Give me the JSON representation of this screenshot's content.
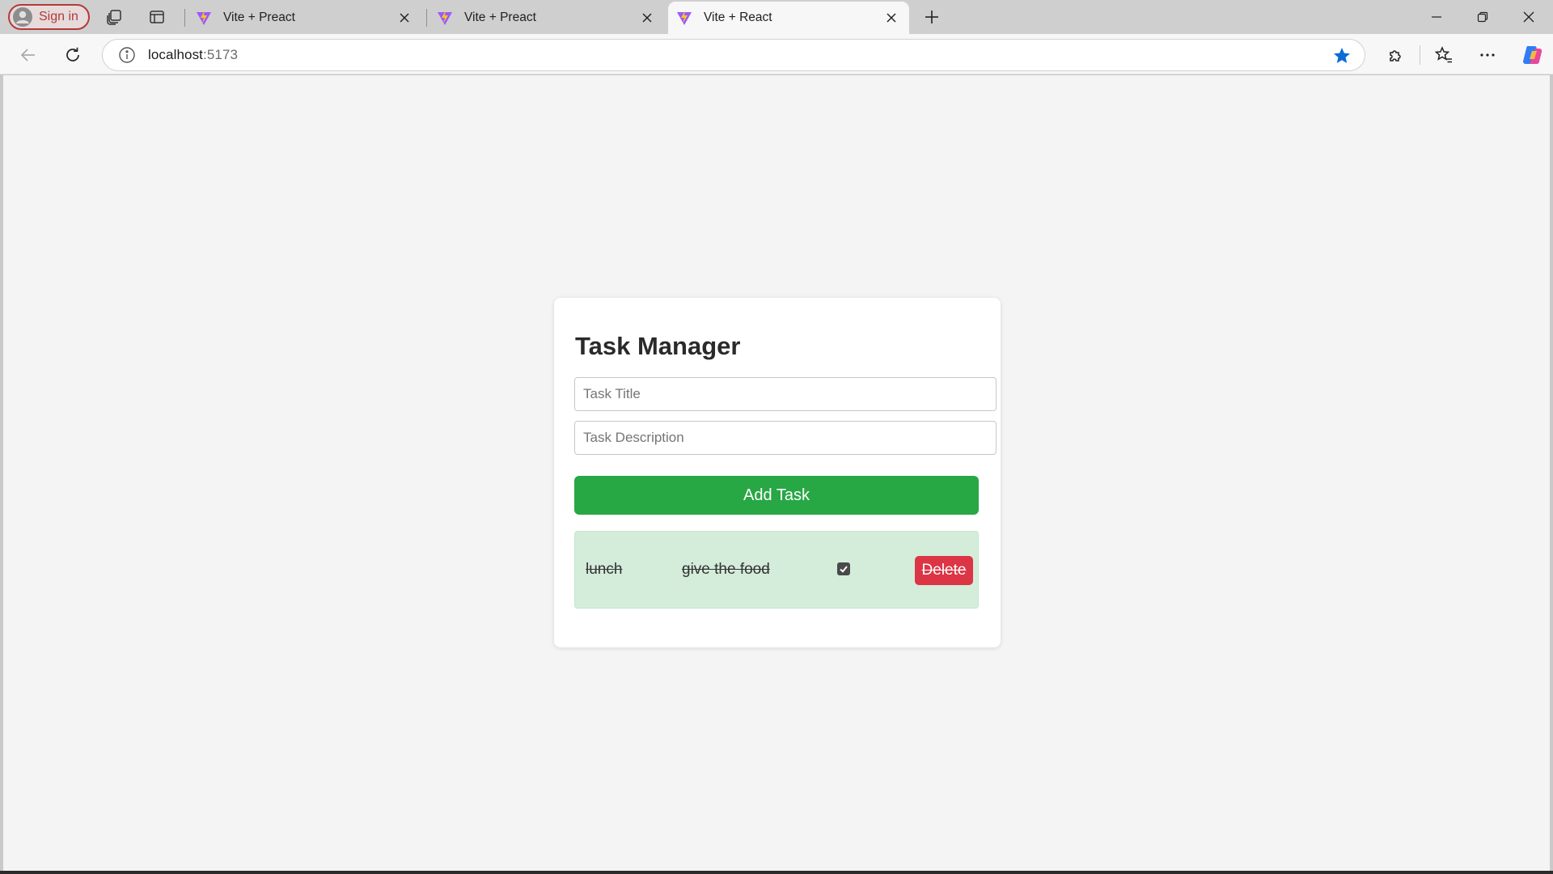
{
  "browser": {
    "signin_label": "Sign in",
    "tabs": [
      {
        "title": "Vite + Preact",
        "favicon": "vite-icon",
        "active": false
      },
      {
        "title": "Vite + Preact",
        "favicon": "vite-icon",
        "active": false
      },
      {
        "title": "Vite + React",
        "favicon": "vite-icon",
        "active": true
      }
    ],
    "address": {
      "host": "localhost",
      "port": ":5173"
    },
    "accent_color": "#0b6cd6"
  },
  "app": {
    "heading": "Task Manager",
    "title_placeholder": "Task Title",
    "description_placeholder": "Task Description",
    "add_button_label": "Add Task",
    "add_button_color": "#28a745",
    "tasks": [
      {
        "title": "lunch",
        "description": "give the food",
        "completed": true,
        "delete_label": "Delete",
        "row_color": "#d4edda",
        "delete_color": "#dc3545"
      }
    ]
  }
}
